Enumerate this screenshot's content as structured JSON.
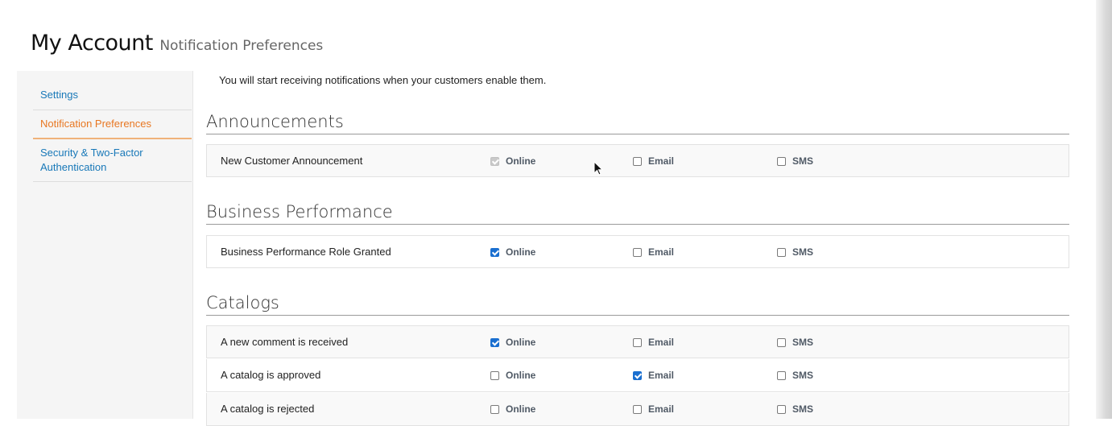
{
  "header": {
    "title": "My Account",
    "subtitle": "Notification Preferences"
  },
  "sidebar": {
    "items": [
      {
        "label": "Settings",
        "active": false
      },
      {
        "label": "Notification Preferences",
        "active": true
      },
      {
        "label": "Security & Two-Factor Authentication",
        "active": false
      }
    ]
  },
  "main": {
    "intro": "You will start receiving notifications when your customers enable them.",
    "option_labels": {
      "online": "Online",
      "email": "Email",
      "sms": "SMS"
    },
    "sections": [
      {
        "title": "Announcements",
        "rows": [
          {
            "label": "New Customer Announcement",
            "online": "disabled-checked",
            "email": "unchecked",
            "sms": "unchecked"
          }
        ]
      },
      {
        "title": "Business Performance",
        "rows": [
          {
            "label": "Business Performance Role Granted",
            "online": "checked",
            "email": "unchecked",
            "sms": "unchecked"
          }
        ]
      },
      {
        "title": "Catalogs",
        "rows": [
          {
            "label": "A new comment is received",
            "online": "checked",
            "email": "unchecked",
            "sms": "unchecked"
          },
          {
            "label": "A catalog is approved",
            "online": "unchecked",
            "email": "checked",
            "sms": "unchecked"
          },
          {
            "label": "A catalog is rejected",
            "online": "unchecked",
            "email": "unchecked",
            "sms": "unchecked"
          }
        ]
      }
    ]
  },
  "colors": {
    "link": "#1878b8",
    "active": "#e87722",
    "checkbox_checked": "#1a6fd0"
  },
  "icons": {
    "cursor": "mouse-pointer-icon"
  }
}
